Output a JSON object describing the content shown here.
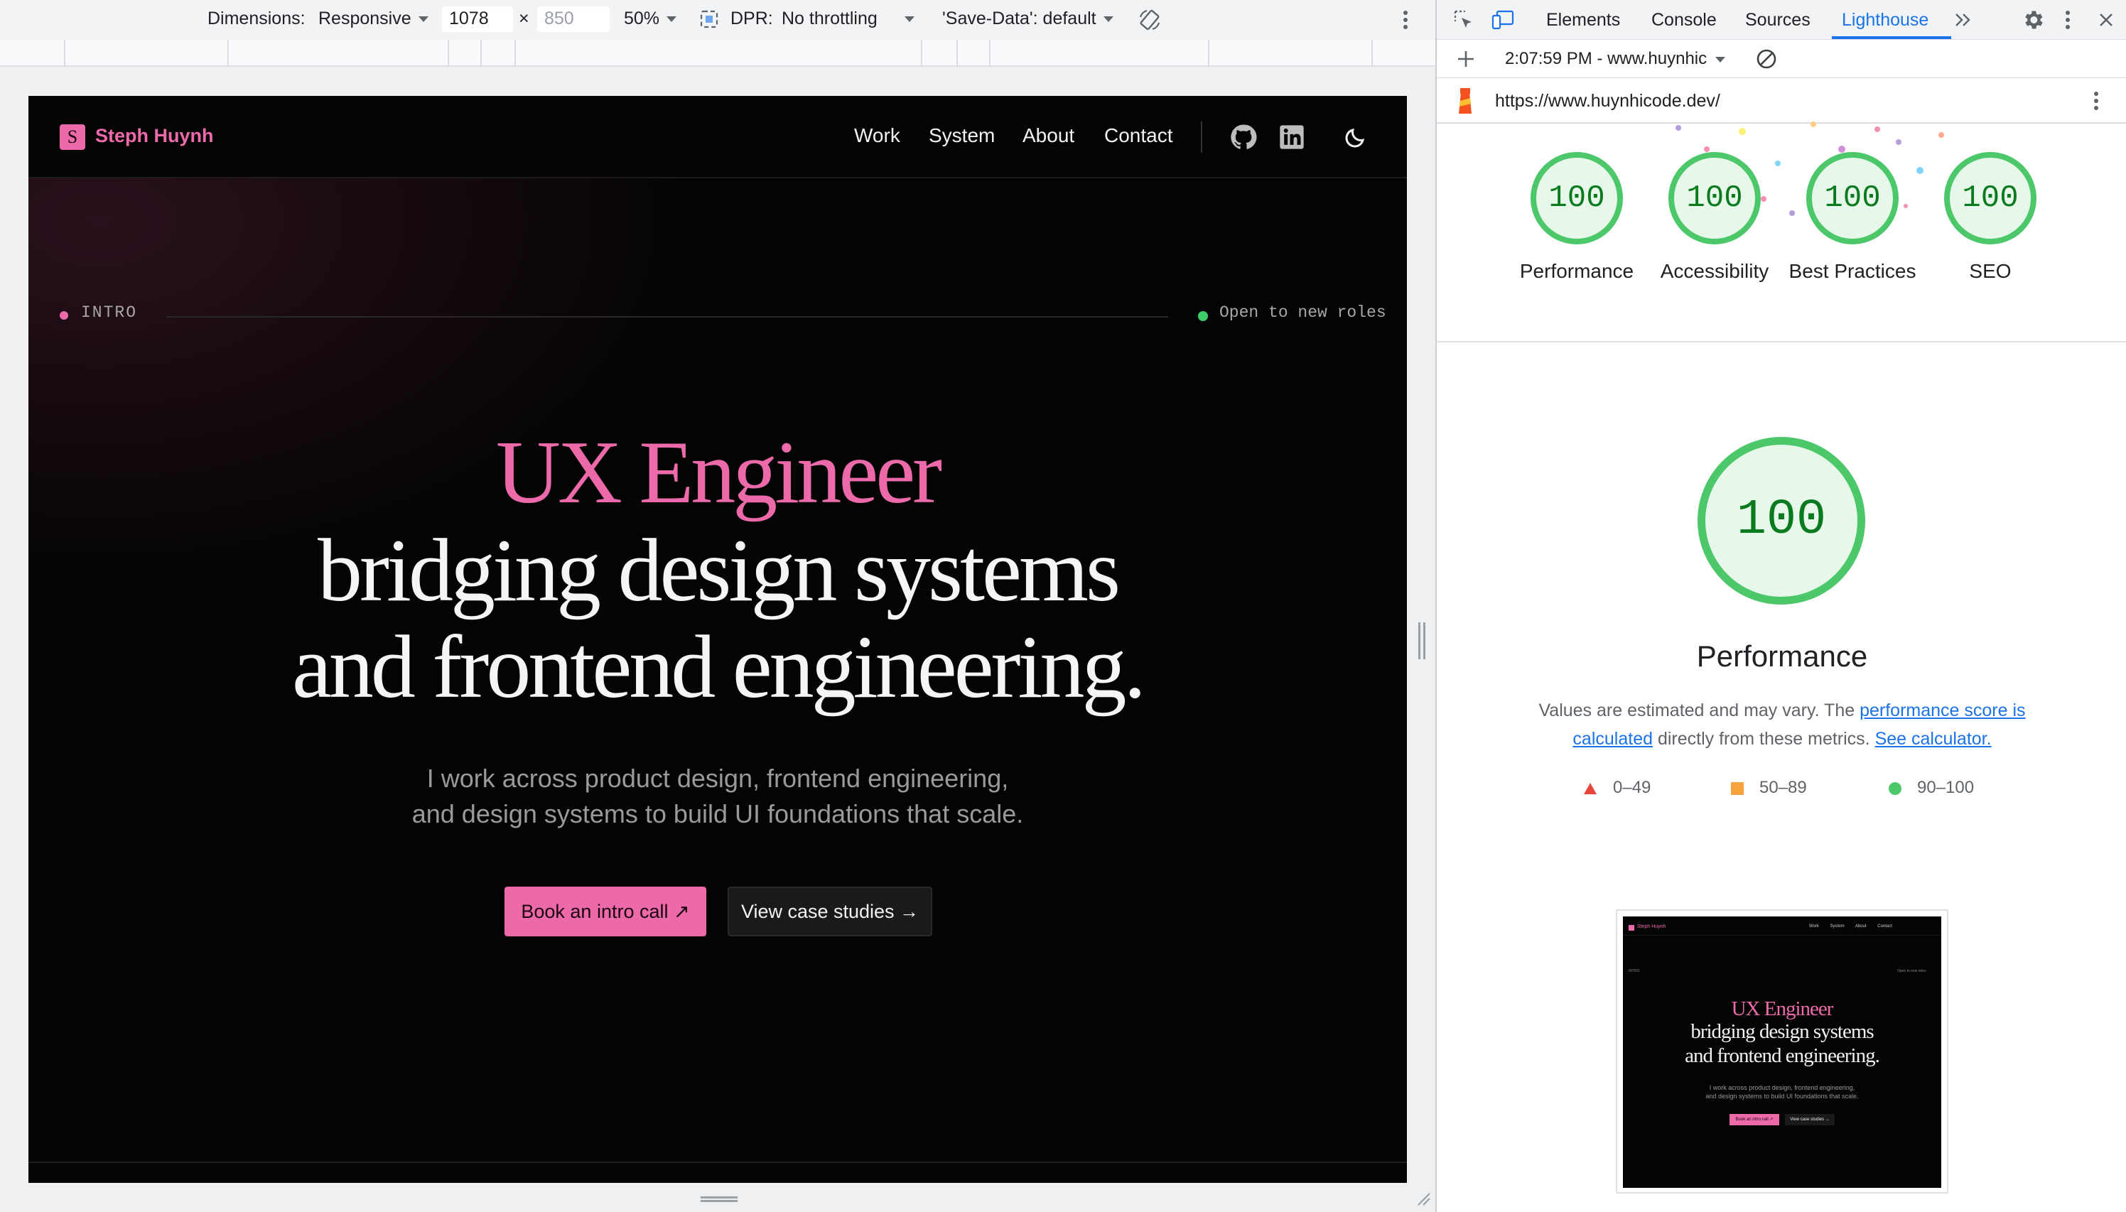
{
  "device_toolbar": {
    "dimensions_label": "Dimensions:",
    "device": "Responsive",
    "width": "1078",
    "times": "×",
    "height_placeholder": "850",
    "zoom": "50%",
    "dpr_label": "DPR:",
    "throttling": "No throttling",
    "save_data": "'Save-Data': default"
  },
  "site": {
    "logo_letter": "S",
    "brand": "Steph Huynh",
    "nav": [
      "Work",
      "System",
      "About",
      "Contact"
    ],
    "intro_label": "INTRO",
    "status": "Open to new roles",
    "headline_accent": "UX Engineer",
    "headline_line2": "bridging design systems",
    "headline_line3": "and frontend engineering.",
    "subline1": "I work across product design, frontend engineering,",
    "subline2": "and design systems to build UI foundations that scale.",
    "cta_primary": "Book an intro call ↗",
    "cta_secondary": "View case studies →"
  },
  "devtools": {
    "tabs": [
      "Elements",
      "Console",
      "Sources",
      "Lighthouse"
    ],
    "active_tab": "Lighthouse",
    "report_time": "2:07:59 PM - www.huynhic",
    "url": "https://www.huynhicode.dev/",
    "scores": [
      {
        "label": "Performance",
        "value": "100"
      },
      {
        "label": "Accessibility",
        "value": "100"
      },
      {
        "label": "Best Practices",
        "value": "100"
      },
      {
        "label": "SEO",
        "value": "100"
      }
    ],
    "detail_score": "100",
    "detail_title": "Performance",
    "desc_pre": "Values are estimated and may vary. The ",
    "desc_link1": "performance score is calculated",
    "desc_mid": " directly from these metrics. ",
    "desc_link2": "See calculator.",
    "legend": [
      {
        "range": "0–49",
        "color": "#e8453c"
      },
      {
        "range": "50–89",
        "color": "#f6a33d"
      },
      {
        "range": "90–100",
        "color": "#4cc86a"
      }
    ],
    "accent_color": "#1a73e8",
    "pass_color": "#4cc86a"
  }
}
